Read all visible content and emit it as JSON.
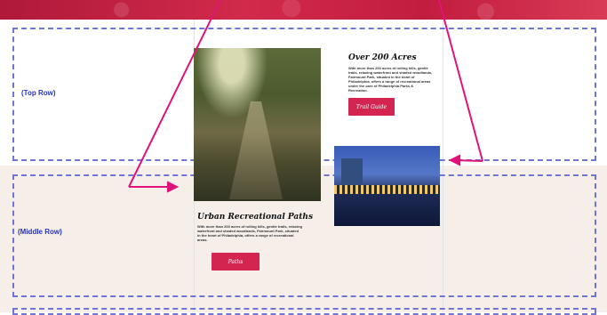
{
  "rows": {
    "top_label": "(Top Row)",
    "middle_label": "(Middle Row)"
  },
  "block_top": {
    "heading": "Over 200 Acres",
    "text": "With more than 200 acres of rolling hills, gentle trails, relaxing waterfront and shaded woodlands, Fairmount Park, situated in the heart of Philadelphia, offers a range of recreational areas under the care of Philadelphia Parks & Recreation.",
    "button_label": "Trail Guide"
  },
  "block_middle": {
    "heading": "Urban Recreational Paths",
    "text": "With more than 200 acres of rolling hills, gentle trails, relaxing waterfront and shaded woodlands, Fairmount Park, situated in the heart of Philadelphia, offers a range of recreational areas.",
    "button_label": "Paths"
  },
  "images": {
    "forest": "forest-trail-photo",
    "city": "city-waterfront-photo"
  },
  "colors": {
    "accent": "#d42550",
    "dashed": "#6f74d6",
    "arrow": "#e0137a",
    "middle_bg": "#f6efe9"
  }
}
